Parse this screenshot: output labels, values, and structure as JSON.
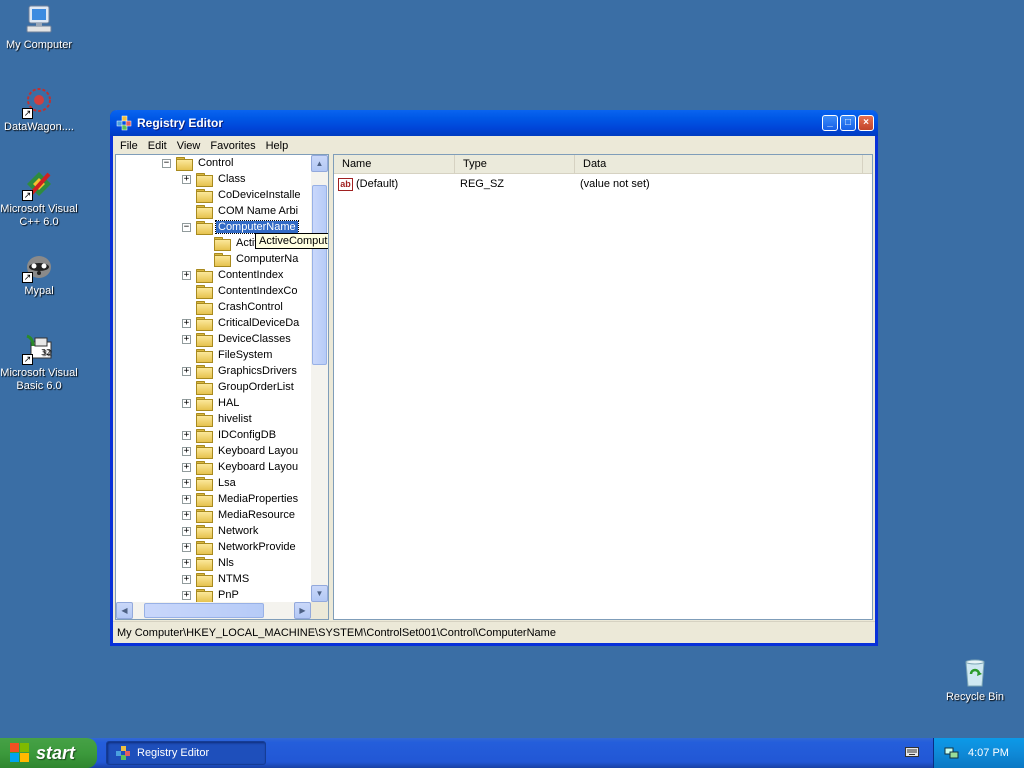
{
  "desktop": {
    "icons": [
      {
        "label": "My Computer",
        "icon": "computer-icon"
      },
      {
        "label": "DataWagon....",
        "icon": "datawagon-icon"
      },
      {
        "label": "Microsoft Visual C++ 6.0",
        "icon": "visual-cpp-icon"
      },
      {
        "label": "Mypal",
        "icon": "mypal-icon"
      },
      {
        "label": "Microsoft Visual Basic 6.0",
        "icon": "visual-basic-icon"
      },
      {
        "label": "Recycle Bin",
        "icon": "recycle-bin-icon"
      }
    ]
  },
  "window": {
    "title": "Registry Editor",
    "menu": [
      "File",
      "Edit",
      "View",
      "Favorites",
      "Help"
    ],
    "tree": {
      "items": [
        {
          "label": "Control",
          "expander": "−"
        },
        {
          "label": "Class",
          "expander": "+"
        },
        {
          "label": "CoDeviceInstalle",
          "expander": ""
        },
        {
          "label": "COM Name Arbi",
          "expander": ""
        },
        {
          "label": "ComputerName",
          "expander": "−"
        },
        {
          "label": "ActiveComputerName",
          "expander": ""
        },
        {
          "label": "ComputerNa",
          "expander": ""
        },
        {
          "label": "ContentIndex",
          "expander": "+"
        },
        {
          "label": "ContentIndexCo",
          "expander": ""
        },
        {
          "label": "CrashControl",
          "expander": ""
        },
        {
          "label": "CriticalDeviceDa",
          "expander": "+"
        },
        {
          "label": "DeviceClasses",
          "expander": "+"
        },
        {
          "label": "FileSystem",
          "expander": ""
        },
        {
          "label": "GraphicsDrivers",
          "expander": "+"
        },
        {
          "label": "GroupOrderList",
          "expander": ""
        },
        {
          "label": "HAL",
          "expander": "+"
        },
        {
          "label": "hivelist",
          "expander": ""
        },
        {
          "label": "IDConfigDB",
          "expander": "+"
        },
        {
          "label": "Keyboard Layou",
          "expander": "+"
        },
        {
          "label": "Keyboard Layou",
          "expander": "+"
        },
        {
          "label": "Lsa",
          "expander": "+"
        },
        {
          "label": "MediaProperties",
          "expander": "+"
        },
        {
          "label": "MediaResource",
          "expander": "+"
        },
        {
          "label": "Network",
          "expander": "+"
        },
        {
          "label": "NetworkProvide",
          "expander": "+"
        },
        {
          "label": "Nls",
          "expander": "+"
        },
        {
          "label": "NTMS",
          "expander": "+"
        },
        {
          "label": "PnP",
          "expander": "+"
        }
      ],
      "tooltip": "ActiveComputerName"
    },
    "list": {
      "columns": [
        "Name",
        "Type",
        "Data"
      ],
      "rows": [
        {
          "name": "(Default)",
          "type": "REG_SZ",
          "data": "(value not set)",
          "icon_text": "ab"
        }
      ]
    },
    "status": "My Computer\\HKEY_LOCAL_MACHINE\\SYSTEM\\ControlSet001\\Control\\ComputerName"
  },
  "taskbar": {
    "start_label": "start",
    "task_label": "Registry Editor",
    "clock": "4:07 PM"
  },
  "colors": {
    "desktop": "#3a6ea5",
    "titlebar": "#0054e3",
    "selection": "#316ac5",
    "start": "#3c9a3c"
  }
}
